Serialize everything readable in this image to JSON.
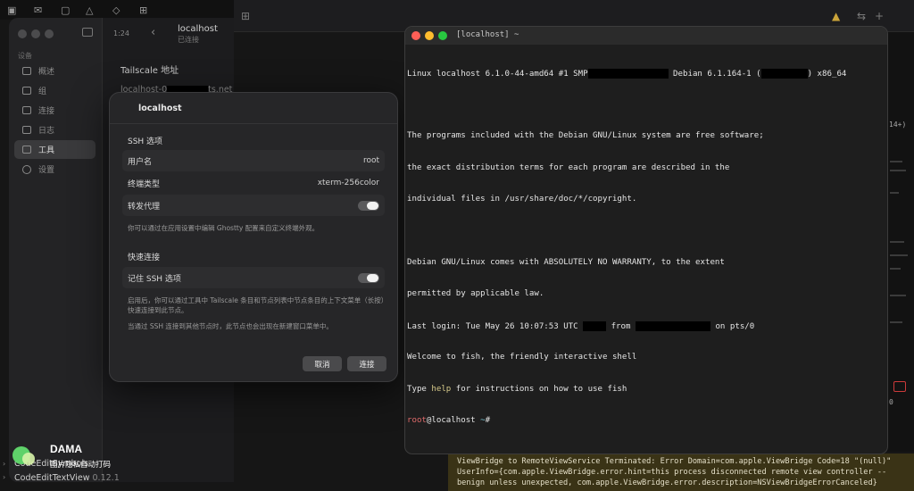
{
  "background": {
    "dim_tab_text": "",
    "right_text": "14+)",
    "right_text2": "0"
  },
  "sidebar": {
    "section_label": "设备",
    "items": [
      {
        "label": "概述",
        "active": false
      },
      {
        "label": "组",
        "active": false
      },
      {
        "label": "连接",
        "active": false
      },
      {
        "label": "日志",
        "active": false
      },
      {
        "label": "工具",
        "active": true
      },
      {
        "label": "设置",
        "active": false
      }
    ],
    "files": [
      {
        "name": "CodeEditSymbols",
        "version": ""
      },
      {
        "name": "CodeEditTextView",
        "version": "0.12.1"
      }
    ]
  },
  "content": {
    "connected_time": "1:24",
    "host_title": "localhost",
    "host_status": "已连接",
    "tailscale_label": "Tailscale 地址",
    "tailscale_addr_prefix": "localhost-0",
    "tailscale_addr_suffix": "ts.net"
  },
  "watermark": {
    "title": "DAMA",
    "subtitle": "图片隐私自动打码"
  },
  "ssh_dialog": {
    "title": "localhost",
    "ssh_options_label": "SSH 选项",
    "username_label": "用户名",
    "username_value": "root",
    "terminal_type_label": "终端类型",
    "terminal_type_value": "xterm-256color",
    "forward_agent_label": "转发代理",
    "forward_agent_on": true,
    "ghostty_note": "你可以通过在应用设置中编辑 Ghostty 配置来自定义终端外观。",
    "quick_connect_label": "快速连接",
    "remember_label": "记住 SSH 选项",
    "remember_on": true,
    "note1": "启用后，你可以通过工具中 Tailscale 条目和节点列表中节点条目的上下文菜单（长按）快速连接到此节点。",
    "note2": "当通过 SSH 连接到其他节点时，此节点也会出现在新建窗口菜单中。",
    "cancel_label": "取消",
    "connect_label": "连接"
  },
  "terminal": {
    "title": "[localhost] ~",
    "line1_a": "Linux localhost 6.1.0-44-amd64 #1 SMP",
    "line1_b": " Debian 6.1.164-1 (",
    "line1_c": ") x86_64",
    "line3": "The programs included with the Debian GNU/Linux system are free software;",
    "line4": "the exact distribution terms for each program are described in the",
    "line5": "individual files in /usr/share/doc/*/copyright.",
    "line7": "Debian GNU/Linux comes with ABSOLUTELY NO WARRANTY, to the extent",
    "line8": "permitted by applicable law.",
    "line9_a": "Last login: Tue May 26 10:07:53 UTC ",
    "line9_b": " from ",
    "line9_c": " on pts/0",
    "line10": "Welcome to fish, the friendly interactive shell",
    "line11_a": "Type ",
    "line11_help": "help",
    "line11_b": " for instructions on how to use fish",
    "prompt_user": "root",
    "prompt_host": "@localhost",
    "prompt_dir": " ~",
    "prompt_sym": "#"
  },
  "log_banner": {
    "line1": "ViewBridge to RemoteViewService Terminated: Error Domain=com.apple.ViewBridge Code=18 \"(null)\"",
    "line2": "UserInfo={com.apple.ViewBridge.error.hint=this process disconnected remote view controller --",
    "line3": "benign unless unexpected, com.apple.ViewBridge.error.description=NSViewBridgeErrorCanceled}"
  },
  "colors": {
    "terminal_bg": "#1e1e1e",
    "dot_red": "#ff5f57",
    "dot_yellow": "#febc2e",
    "dot_green": "#28c840",
    "log_banner_bg": "#3a3316"
  }
}
